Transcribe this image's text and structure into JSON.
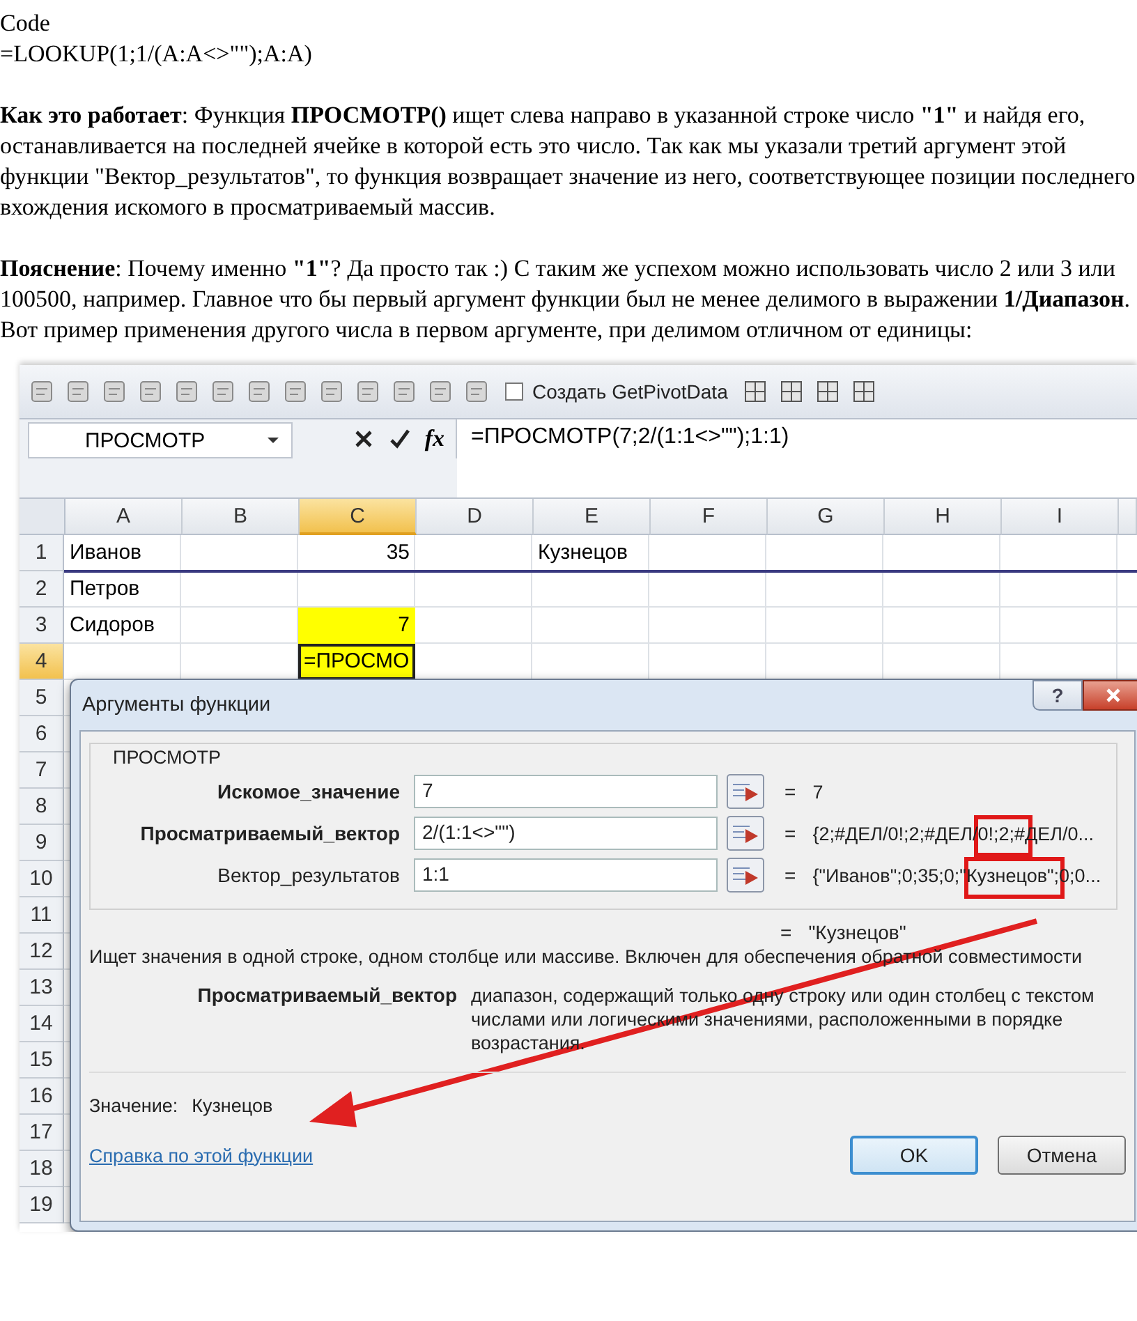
{
  "document": {
    "code_label": "Code",
    "code": "=LOOKUP(1;1/(A:A<>\"\");A:A)",
    "paragraphs": [
      "**Как это работает**: Функция **ПРОСМОТР()** ищет слева направо в указанной строке число **\"1\"** и найдя его, останавливается на последней ячейке в которой есть это число. Так как мы указали третий аргумент этой функции \"Вектор_результатов\", то функция возвращает значение из него, соответствующее позиции последнего вхождения искомого в просматриваемый массив.",
      "**Пояснение**: Почему именно **\"1\"**? Да просто так :) С таким же успехом можно использовать число 2 или 3 или 100500, например. Главное что бы первый аргумент функции был не менее делимого в выражении **1/Диапазон**. Вот пример применения другого числа в первом аргументе, при делимом отличном от единицы:"
    ]
  },
  "screenshot": {
    "toolbar": {
      "pivot_button": "Создать GetPivotData"
    },
    "formula_bar": {
      "name_box": "ПРОСМОТР",
      "fx_label": "fx",
      "formula": "=ПРОСМОТР(7;2/(1:1<>\"\");1:1)"
    },
    "columns": [
      {
        "label": "A",
        "selected": false
      },
      {
        "label": "B",
        "selected": false
      },
      {
        "label": "C",
        "selected": true
      },
      {
        "label": "D",
        "selected": false
      },
      {
        "label": "E",
        "selected": false
      },
      {
        "label": "F",
        "selected": false
      },
      {
        "label": "G",
        "selected": false
      },
      {
        "label": "H",
        "selected": false
      },
      {
        "label": "I",
        "selected": false
      }
    ],
    "rows": [
      {
        "number": "1",
        "selected": false,
        "outlined": true,
        "cells": [
          {
            "text": "Иванов",
            "kind": "text",
            "highlighted": false,
            "active": false
          },
          null,
          {
            "text": "35",
            "kind": "number",
            "highlighted": false,
            "active": false
          },
          null,
          {
            "text": "Кузнецов",
            "kind": "text",
            "highlighted": false,
            "active": false
          },
          null,
          null,
          null,
          null
        ]
      },
      {
        "number": "2",
        "selected": false,
        "outlined": false,
        "cells": [
          {
            "text": "Петров",
            "kind": "text",
            "highlighted": false,
            "active": false
          },
          null,
          null,
          null,
          null,
          null,
          null,
          null,
          null
        ]
      },
      {
        "number": "3",
        "selected": false,
        "outlined": false,
        "cells": [
          {
            "text": "Сидоров",
            "kind": "text",
            "highlighted": false,
            "active": false
          },
          null,
          {
            "text": "7",
            "kind": "number",
            "highlighted": true,
            "active": false
          },
          null,
          null,
          null,
          null,
          null,
          null
        ]
      },
      {
        "number": "4",
        "selected": true,
        "outlined": false,
        "cells": [
          null,
          null,
          {
            "text": "=ПРОСМО",
            "kind": "text",
            "highlighted": true,
            "active": true
          },
          null,
          null,
          null,
          null,
          null,
          null
        ]
      },
      {
        "number": "5",
        "selected": false,
        "outlined": false,
        "cells": []
      },
      {
        "number": "6",
        "selected": false,
        "outlined": false,
        "cells": []
      },
      {
        "number": "7",
        "selected": false,
        "outlined": false,
        "cells": []
      },
      {
        "number": "8",
        "selected": false,
        "outlined": false,
        "cells": []
      },
      {
        "number": "9",
        "selected": false,
        "outlined": false,
        "cells": []
      },
      {
        "number": "10",
        "selected": false,
        "outlined": false,
        "cells": []
      },
      {
        "number": "11",
        "selected": false,
        "outlined": false,
        "cells": []
      },
      {
        "number": "12",
        "selected": false,
        "outlined": false,
        "cells": []
      },
      {
        "number": "13",
        "selected": false,
        "outlined": false,
        "cells": []
      },
      {
        "number": "14",
        "selected": false,
        "outlined": false,
        "cells": []
      },
      {
        "number": "15",
        "selected": false,
        "outlined": false,
        "cells": []
      },
      {
        "number": "16",
        "selected": false,
        "outlined": false,
        "cells": []
      },
      {
        "number": "17",
        "selected": false,
        "outlined": false,
        "cells": []
      },
      {
        "number": "18",
        "selected": false,
        "outlined": false,
        "cells": []
      },
      {
        "number": "19",
        "selected": false,
        "outlined": false,
        "cells": []
      }
    ],
    "dialog": {
      "title": "Аргументы функции",
      "help_button": "?",
      "function_name": "ПРОСМОТР",
      "arguments": [
        {
          "label": "Искомое_значение",
          "bold": true,
          "value": "7",
          "result": "7"
        },
        {
          "label": "Просматриваемый_вектор",
          "bold": true,
          "value": "2/(1:1<>\"\")",
          "result": "{2;#ДЕЛ/0!;2;#ДЕЛ/0!;2;#ДЕЛ/0..."
        },
        {
          "label": "Вектор_результатов",
          "bold": false,
          "value": "1:1",
          "result": "{\"Иванов\";0;35;0;\"Кузнецов\";0;0..."
        }
      ],
      "equals": "=",
      "formula_result": "\"Кузнецов\"",
      "description": "Ищет значения в одной строке, одном столбце или массиве. Включен для обеспечения обратной совместимости",
      "argument_help": {
        "label": "Просматриваемый_вектор",
        "lines": [
          "диапазон, содержащий только одну строку или один столбец с текстом",
          "числами или логическими значениями, расположенными в порядке",
          "возрастания."
        ]
      },
      "value_label": "Значение:",
      "value": "Кузнецов",
      "help_link": "Справка по этой функции",
      "buttons": [
        {
          "label": "OK",
          "selected": true
        },
        {
          "label": "Отмена",
          "selected": false
        }
      ]
    }
  }
}
